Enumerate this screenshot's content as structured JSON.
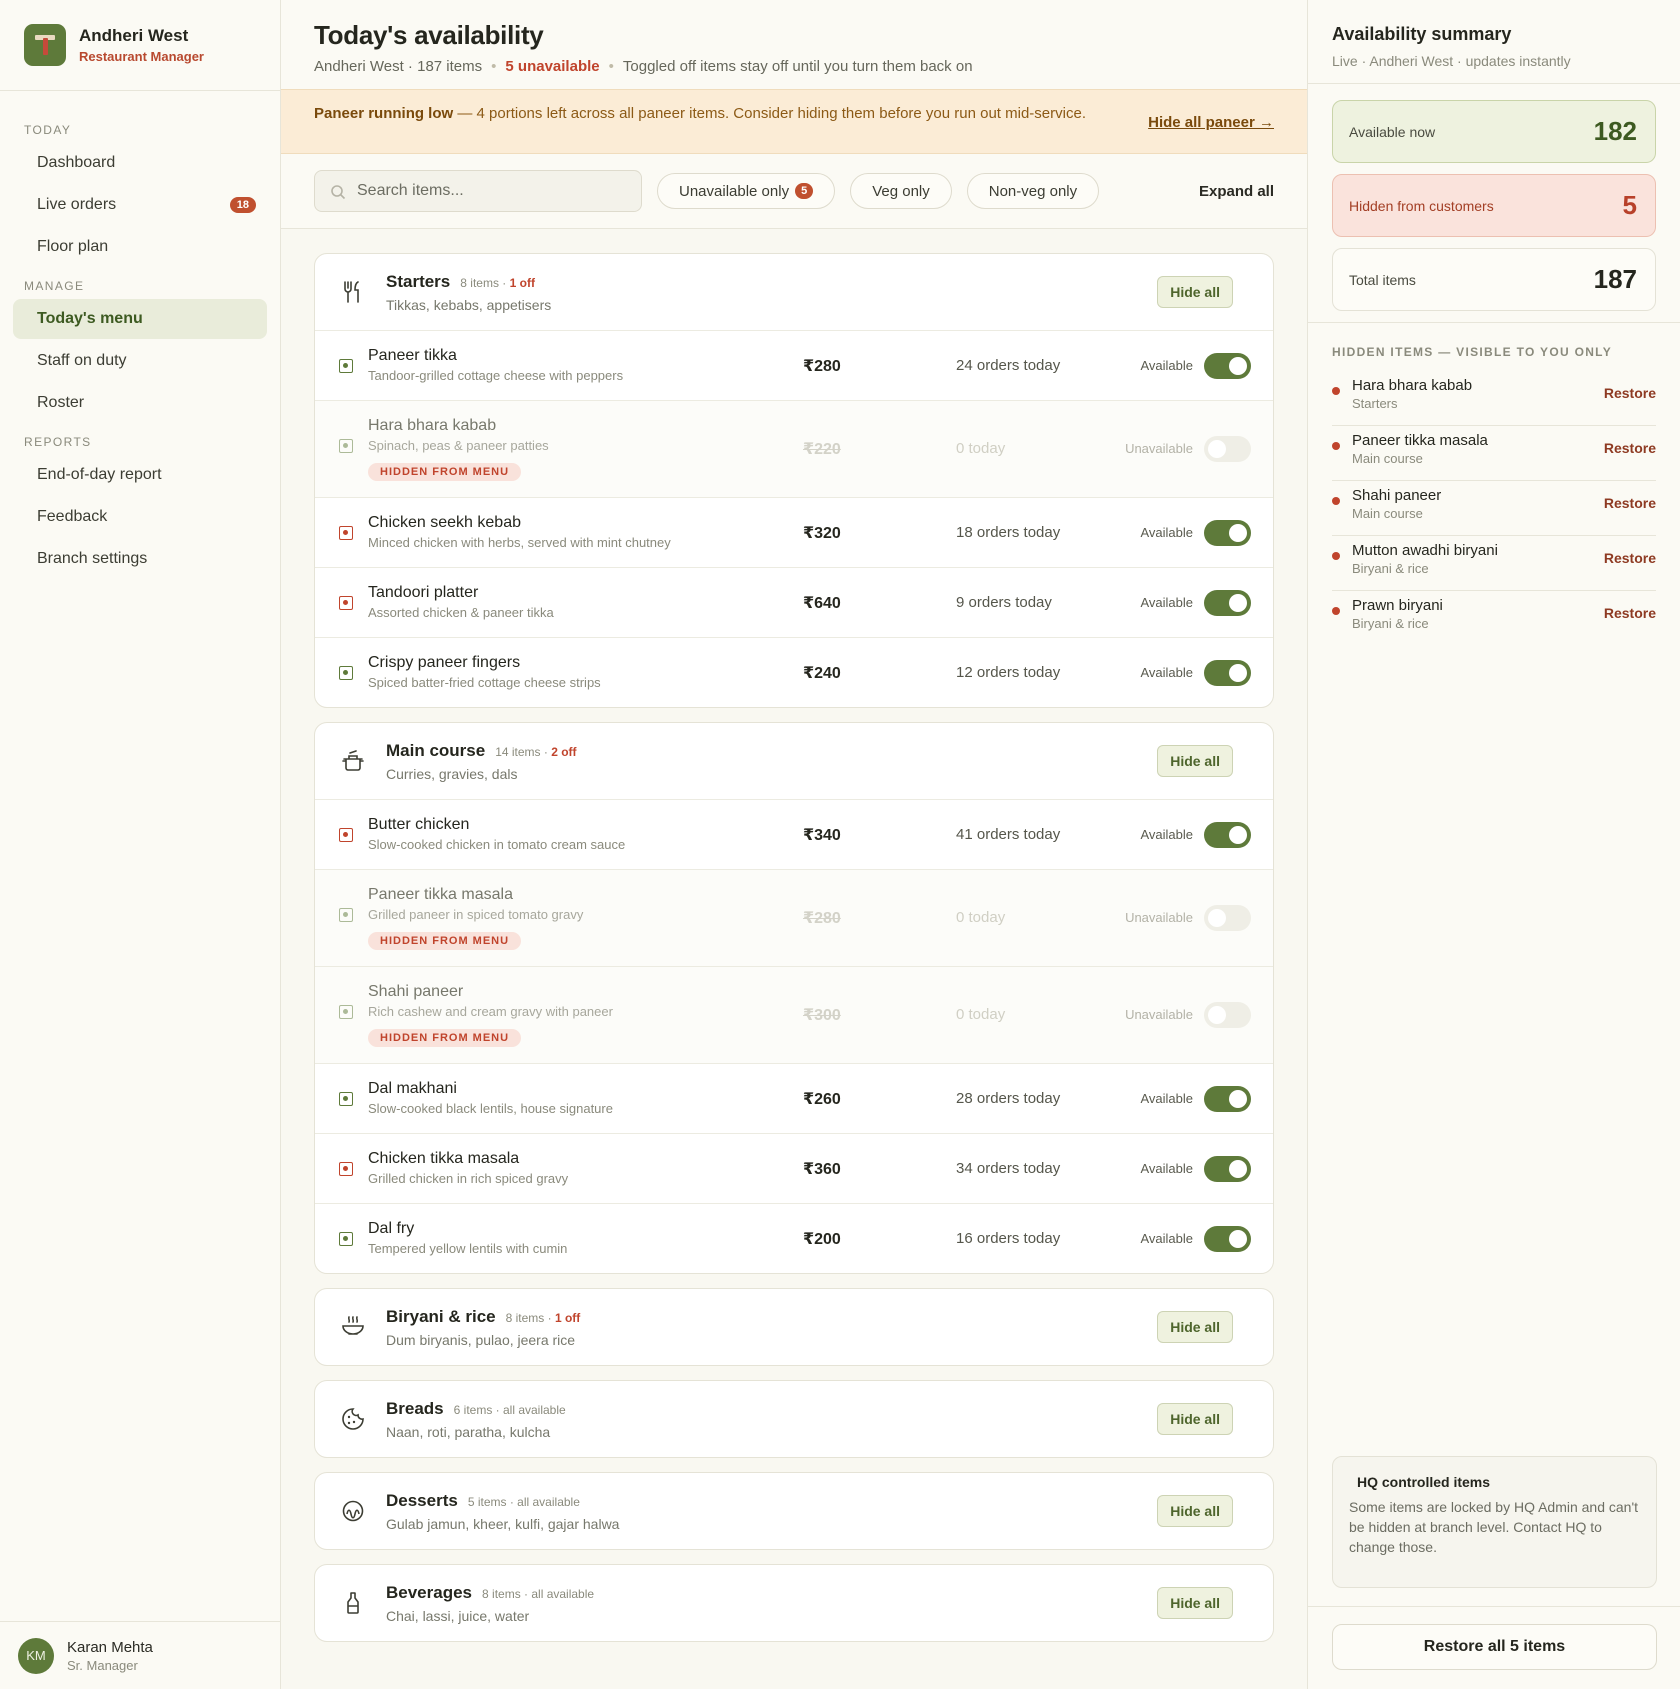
{
  "brand": {
    "name": "Andheri West",
    "role": "Restaurant Manager"
  },
  "nav": {
    "sections": [
      {
        "label": "TODAY",
        "items": [
          {
            "label": "Dashboard"
          },
          {
            "label": "Live orders",
            "badge": "18"
          },
          {
            "label": "Floor plan"
          }
        ]
      },
      {
        "label": "MANAGE",
        "items": [
          {
            "label": "Today's menu",
            "active": true
          },
          {
            "label": "Staff on duty"
          },
          {
            "label": "Roster"
          }
        ]
      },
      {
        "label": "REPORTS",
        "items": [
          {
            "label": "End-of-day report"
          },
          {
            "label": "Feedback"
          },
          {
            "label": "Branch settings"
          }
        ]
      }
    ]
  },
  "user": {
    "initials": "KM",
    "name": "Karan Mehta",
    "role": "Sr. Manager"
  },
  "header": {
    "title": "Today's availability",
    "branch_items": "Andheri West · 187 items",
    "unavailable": "5 unavailable",
    "note": "Toggled off items stay off until you turn them back on"
  },
  "alert": {
    "bold": "Paneer running low",
    "text": " — 4 portions left across all paneer items. Consider hiding them before you run out mid-service.",
    "link": "Hide all paneer →"
  },
  "filters": {
    "search_placeholder": "Search items...",
    "unavailable_only": "Unavailable only",
    "unavailable_count": "5",
    "veg_only": "Veg only",
    "nonveg_only": "Non-veg only",
    "expand_all": "Expand all"
  },
  "hide_all_label": "Hide all",
  "hidden_tag": "HIDDEN FROM MENU",
  "categories": [
    {
      "icon": "fork-knife-icon",
      "title": "Starters",
      "meta": "8 items · ",
      "off": "1 off",
      "desc": "Tikkas, kebabs, appetisers",
      "items": [
        {
          "type": "veg",
          "name": "Paneer tikka",
          "desc": "Tandoor-grilled cottage cheese with peppers",
          "price": "₹280",
          "orders": "24 orders today",
          "status": "Available",
          "on": true
        },
        {
          "type": "veg",
          "name": "Hara bhara kabab",
          "desc": "Spinach, peas & paneer patties",
          "price": "₹220",
          "orders": "0 today",
          "status": "Unavailable",
          "on": false
        },
        {
          "type": "nv",
          "name": "Chicken seekh kebab",
          "desc": "Minced chicken with herbs, served with mint chutney",
          "price": "₹320",
          "orders": "18 orders today",
          "status": "Available",
          "on": true
        },
        {
          "type": "nv",
          "name": "Tandoori platter",
          "desc": "Assorted chicken & paneer tikka",
          "price": "₹640",
          "orders": "9 orders today",
          "status": "Available",
          "on": true
        },
        {
          "type": "veg",
          "name": "Crispy paneer fingers",
          "desc": "Spiced batter-fried cottage cheese strips",
          "price": "₹240",
          "orders": "12 orders today",
          "status": "Available",
          "on": true
        }
      ]
    },
    {
      "icon": "pot-icon",
      "title": "Main course",
      "meta": "14 items · ",
      "off": "2 off",
      "desc": "Curries, gravies, dals",
      "items": [
        {
          "type": "nv",
          "name": "Butter chicken",
          "desc": "Slow-cooked chicken in tomato cream sauce",
          "price": "₹340",
          "orders": "41 orders today",
          "status": "Available",
          "on": true
        },
        {
          "type": "veg",
          "name": "Paneer tikka masala",
          "desc": "Grilled paneer in spiced tomato gravy",
          "price": "₹280",
          "orders": "0 today",
          "status": "Unavailable",
          "on": false
        },
        {
          "type": "veg",
          "name": "Shahi paneer",
          "desc": "Rich cashew and cream gravy with paneer",
          "price": "₹300",
          "orders": "0 today",
          "status": "Unavailable",
          "on": false
        },
        {
          "type": "veg",
          "name": "Dal makhani",
          "desc": "Slow-cooked black lentils, house signature",
          "price": "₹260",
          "orders": "28 orders today",
          "status": "Available",
          "on": true
        },
        {
          "type": "nv",
          "name": "Chicken tikka masala",
          "desc": "Grilled chicken in rich spiced gravy",
          "price": "₹360",
          "orders": "34 orders today",
          "status": "Available",
          "on": true
        },
        {
          "type": "veg",
          "name": "Dal fry",
          "desc": "Tempered yellow lentils with cumin",
          "price": "₹200",
          "orders": "16 orders today",
          "status": "Available",
          "on": true
        }
      ]
    },
    {
      "icon": "biryani-bowl-icon",
      "title": "Biryani & rice",
      "meta": "8 items · ",
      "off": "1 off",
      "desc": "Dum biryanis, pulao, jeera rice",
      "items": []
    },
    {
      "icon": "cookie-icon",
      "title": "Breads",
      "meta": "6 items · all available",
      "off": "",
      "desc": "Naan, roti, paratha, kulcha",
      "items": []
    },
    {
      "icon": "dessert-icon",
      "title": "Desserts",
      "meta": "5 items · all available",
      "off": "",
      "desc": "Gulab jamun, kheer, kulfi, gajar halwa",
      "items": []
    },
    {
      "icon": "bottle-icon",
      "title": "Beverages",
      "meta": "8 items · all available",
      "off": "",
      "desc": "Chai, lassi, juice, water",
      "items": []
    }
  ],
  "summary": {
    "title": "Availability summary",
    "sub": "Live · Andheri West · updates instantly",
    "available_label": "Available now",
    "available_value": "182",
    "hidden_label": "Hidden from customers",
    "hidden_value": "5",
    "total_label": "Total items",
    "total_value": "187",
    "hidden_section_title": "HIDDEN ITEMS — VISIBLE TO YOU ONLY",
    "restore_label": "Restore",
    "hidden_items": [
      {
        "name": "Hara bhara kabab",
        "cat": "Starters"
      },
      {
        "name": "Paneer tikka masala",
        "cat": "Main course"
      },
      {
        "name": "Shahi paneer",
        "cat": "Main course"
      },
      {
        "name": "Mutton awadhi biryani",
        "cat": "Biryani & rice"
      },
      {
        "name": "Prawn biryani",
        "cat": "Biryani & rice"
      }
    ],
    "hq_title": "HQ controlled items",
    "hq_text": "Some items are locked by HQ Admin and can't be hidden at branch level. Contact HQ to change those.",
    "restore_all": "Restore all 5 items"
  },
  "colors": {
    "accent": "#5e7a3a",
    "danger": "#c0442c",
    "warning_bg": "#fbecd6"
  }
}
